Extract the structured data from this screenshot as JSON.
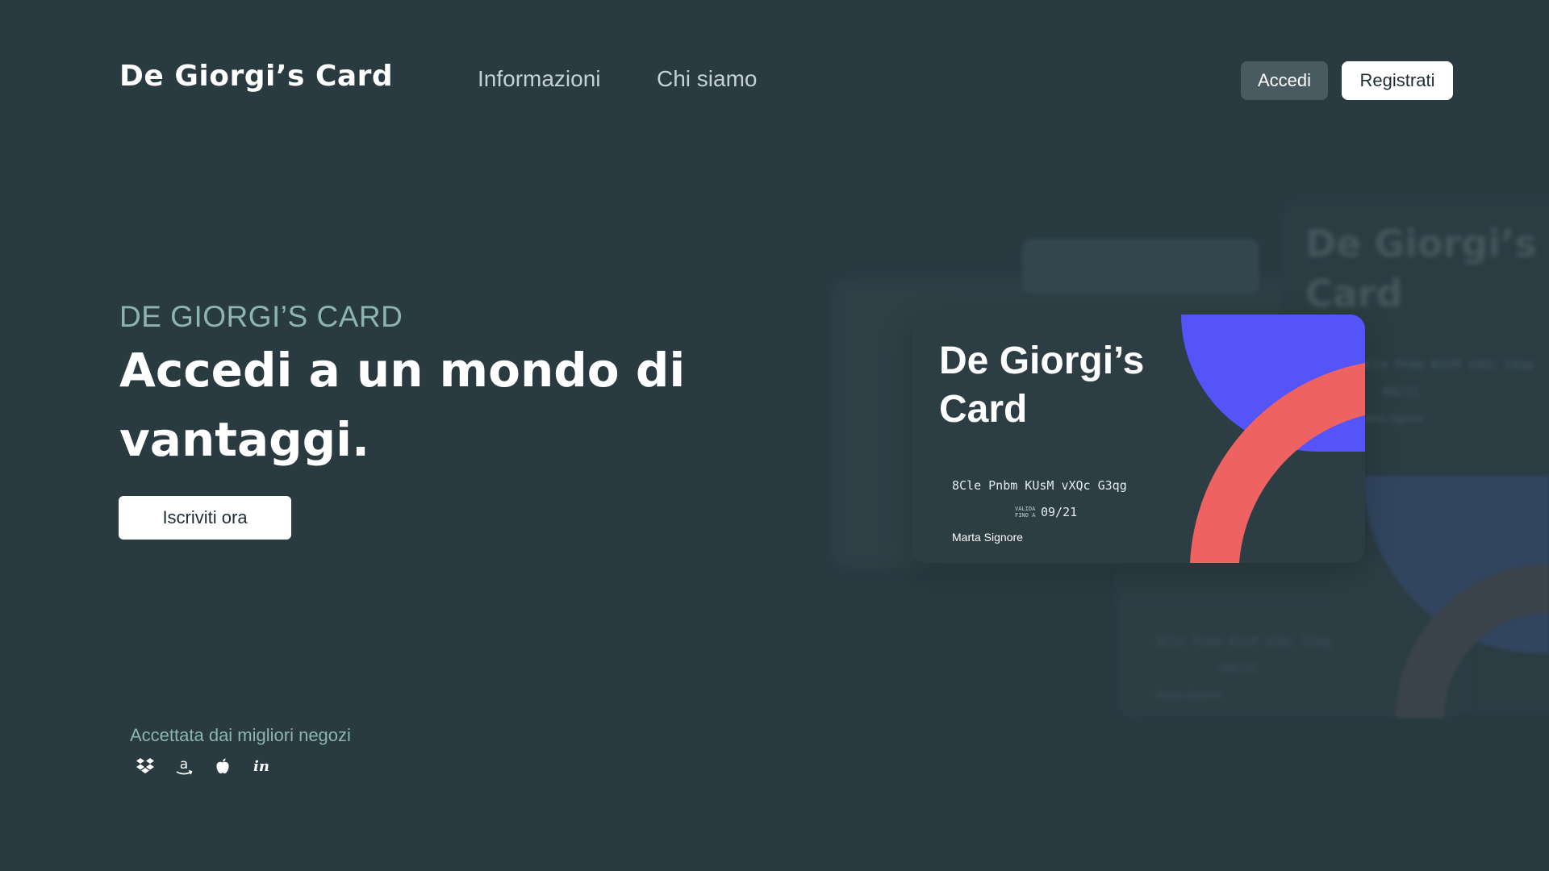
{
  "header": {
    "brand": "De Giorgi’s Card",
    "nav": [
      {
        "label": "Informazioni"
      },
      {
        "label": "Chi siamo"
      }
    ],
    "login_label": "Accedi",
    "register_label": "Registrati"
  },
  "hero": {
    "eyebrow": "DE GIORGI’S CARD",
    "headline": "Accedi a un mondo di vantaggi.",
    "cta_label": "Iscriviti ora"
  },
  "partners": {
    "caption": "Accettata dai migliori negozi",
    "logos": [
      "dropbox-icon",
      "amazon-icon",
      "apple-icon",
      "invision-icon"
    ]
  },
  "card": {
    "title": "De Giorgi’s Card",
    "number": "8Cle Pnbm KUsM vXQc G3qg",
    "expiry_label": "VALIDA\nFINO A",
    "expiry": "09/21",
    "holder": "Marta Signore"
  },
  "colors": {
    "background": "#293a41",
    "accent_blue": "#5454f8",
    "accent_red": "#ef6262",
    "eyebrow": "#8db5b0"
  }
}
